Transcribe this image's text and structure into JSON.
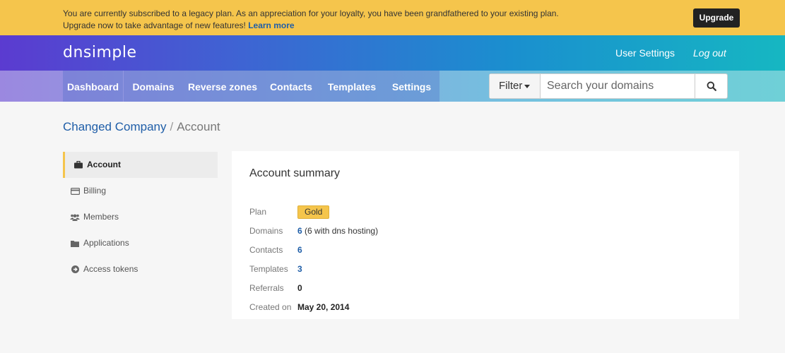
{
  "banner": {
    "line1": "You are currently subscribed to a legacy plan. As an appreciation for your loyalty, you have been grandfathered to your existing plan.",
    "line2": "Upgrade now to take advantage of new features!",
    "learn_more": "Learn more",
    "upgrade_label": "Upgrade"
  },
  "header": {
    "logo": "dnsimple",
    "user_settings": "User Settings",
    "logout": "Log out"
  },
  "nav": {
    "tabs": [
      "Dashboard",
      "Domains",
      "Reverse zones",
      "Contacts",
      "Templates",
      "Settings"
    ]
  },
  "search": {
    "filter_label": "Filter",
    "placeholder": "Search your domains"
  },
  "breadcrumb": {
    "company": "Changed Company",
    "separator": "/",
    "current": "Account"
  },
  "sidebar": {
    "items": [
      {
        "label": "Account",
        "icon": "briefcase-icon",
        "active": true
      },
      {
        "label": "Billing",
        "icon": "credit-card-icon"
      },
      {
        "label": "Members",
        "icon": "users-icon"
      },
      {
        "label": "Applications",
        "icon": "folder-icon"
      },
      {
        "label": "Access tokens",
        "icon": "arrow-circle-icon"
      }
    ]
  },
  "summary": {
    "title": "Account summary",
    "plan_label": "Plan",
    "plan_value": "Gold",
    "domains_label": "Domains",
    "domains_count": "6",
    "domains_note": "(6 with dns hosting)",
    "contacts_label": "Contacts",
    "contacts_count": "6",
    "templates_label": "Templates",
    "templates_count": "3",
    "referrals_label": "Referrals",
    "referrals_count": "0",
    "created_label": "Created on",
    "created_value": "May 20, 2014"
  },
  "colors": {
    "banner": "#f5c54c",
    "link": "#1f5ea8",
    "badge": "#f5c54c"
  }
}
